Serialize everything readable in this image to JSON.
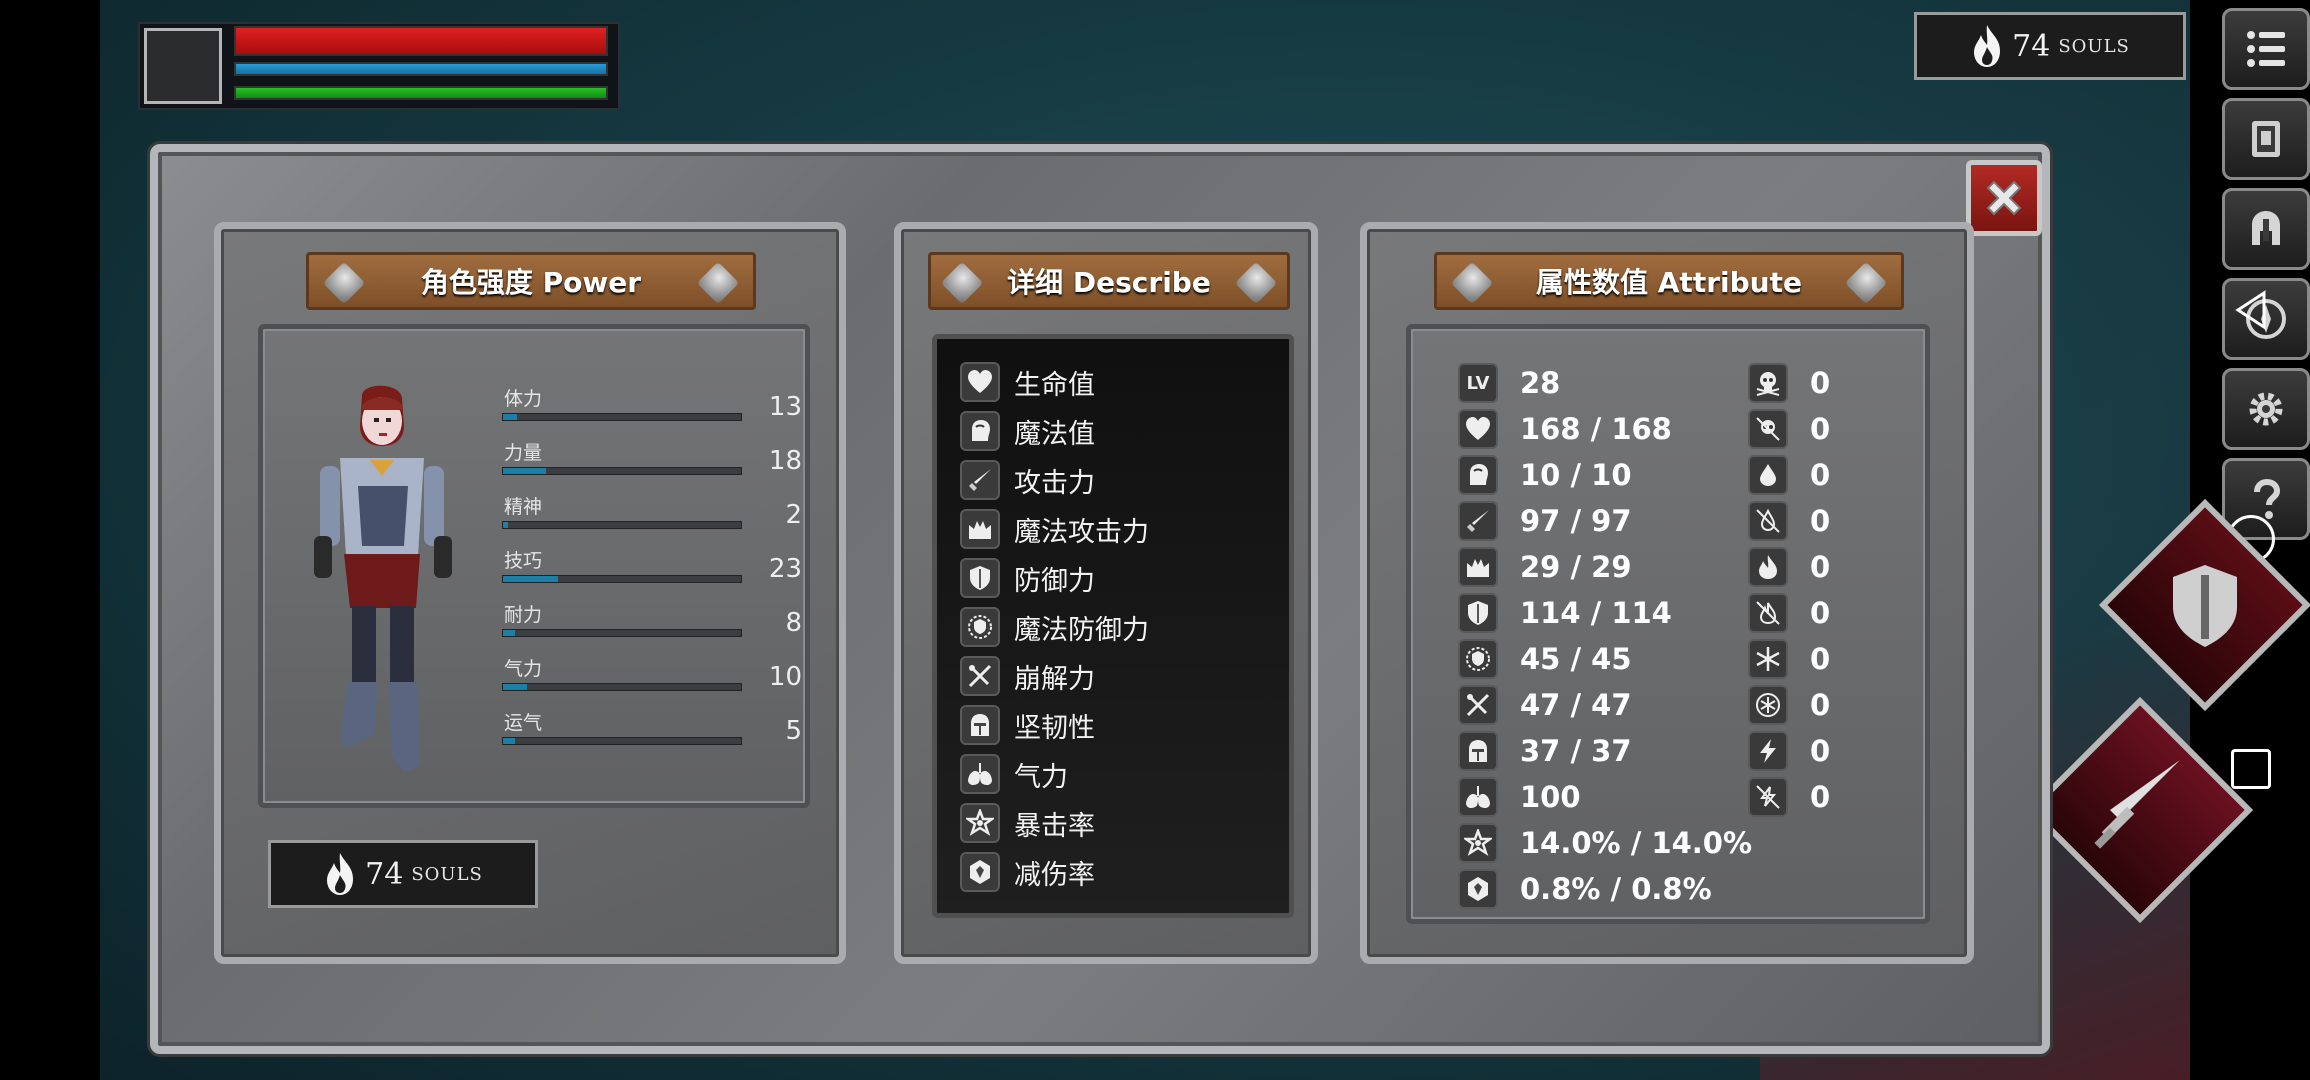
{
  "hud": {
    "souls_count": "74",
    "souls_label": "SOULS",
    "hp_fraction": 1.0,
    "mp_fraction": 1.0,
    "sp_fraction": 1.0
  },
  "side_menu": {
    "icons": [
      "menu-list-icon",
      "inventory-book-icon",
      "helmet-icon",
      "compass-icon",
      "settings-gear-icon",
      "help-question-icon"
    ]
  },
  "power_panel": {
    "title": "角色强度 Power",
    "stats": [
      {
        "label": "体力",
        "value": "13",
        "fraction": 0.06
      },
      {
        "label": "力量",
        "value": "18",
        "fraction": 0.18
      },
      {
        "label": "精神",
        "value": "2",
        "fraction": 0.02
      },
      {
        "label": "技巧",
        "value": "23",
        "fraction": 0.23
      },
      {
        "label": "耐力",
        "value": "8",
        "fraction": 0.05
      },
      {
        "label": "气力",
        "value": "10",
        "fraction": 0.1
      },
      {
        "label": "运气",
        "value": "5",
        "fraction": 0.05
      }
    ],
    "souls_count": "74",
    "souls_label": "SOULS"
  },
  "describe_panel": {
    "title": "详细 Describe",
    "rows": [
      {
        "icon": "heart-icon",
        "label": "生命值"
      },
      {
        "icon": "mana-head-icon",
        "label": "魔法值"
      },
      {
        "icon": "sword-icon",
        "label": "攻击力"
      },
      {
        "icon": "magic-crown-icon",
        "label": "魔法攻击力"
      },
      {
        "icon": "shield-icon",
        "label": "防御力"
      },
      {
        "icon": "magic-shield-icon",
        "label": "魔法防御力"
      },
      {
        "icon": "break-icon",
        "label": "崩解力"
      },
      {
        "icon": "helm-icon",
        "label": "坚韧性"
      },
      {
        "icon": "lungs-icon",
        "label": "气力"
      },
      {
        "icon": "critical-star-icon",
        "label": "暴击率"
      },
      {
        "icon": "damage-reduction-icon",
        "label": "减伤率"
      }
    ]
  },
  "attribute_panel": {
    "title": "属性数值 Attribute",
    "left": [
      {
        "icon": "level-icon",
        "icon_text": "LV",
        "value": "28"
      },
      {
        "icon": "heart-icon",
        "value": "168 / 168"
      },
      {
        "icon": "mana-head-icon",
        "value": "10 / 10"
      },
      {
        "icon": "sword-icon",
        "value": "97 / 97"
      },
      {
        "icon": "magic-crown-icon",
        "value": "29 / 29"
      },
      {
        "icon": "shield-icon",
        "value": "114 / 114"
      },
      {
        "icon": "magic-shield-icon",
        "value": "45 / 45"
      },
      {
        "icon": "break-icon",
        "value": "47 / 47"
      },
      {
        "icon": "helm-icon",
        "value": "37 / 37"
      },
      {
        "icon": "lungs-icon",
        "value": "100"
      },
      {
        "icon": "critical-star-icon",
        "value": "14.0% / 14.0%"
      },
      {
        "icon": "damage-reduction-icon",
        "value": "0.8% / 0.8%"
      }
    ],
    "right": [
      {
        "icon": "poison-skull-icon",
        "value": "0"
      },
      {
        "icon": "poison-resist-icon",
        "value": "0"
      },
      {
        "icon": "bleed-drop-icon",
        "value": "0"
      },
      {
        "icon": "bleed-resist-icon",
        "value": "0"
      },
      {
        "icon": "fire-icon",
        "value": "0"
      },
      {
        "icon": "fire-resist-icon",
        "value": "0"
      },
      {
        "icon": "frost-icon",
        "value": "0"
      },
      {
        "icon": "frost-resist-icon",
        "value": "0"
      },
      {
        "icon": "lightning-icon",
        "value": "0"
      },
      {
        "icon": "lightning-resist-icon",
        "value": "0"
      }
    ]
  }
}
